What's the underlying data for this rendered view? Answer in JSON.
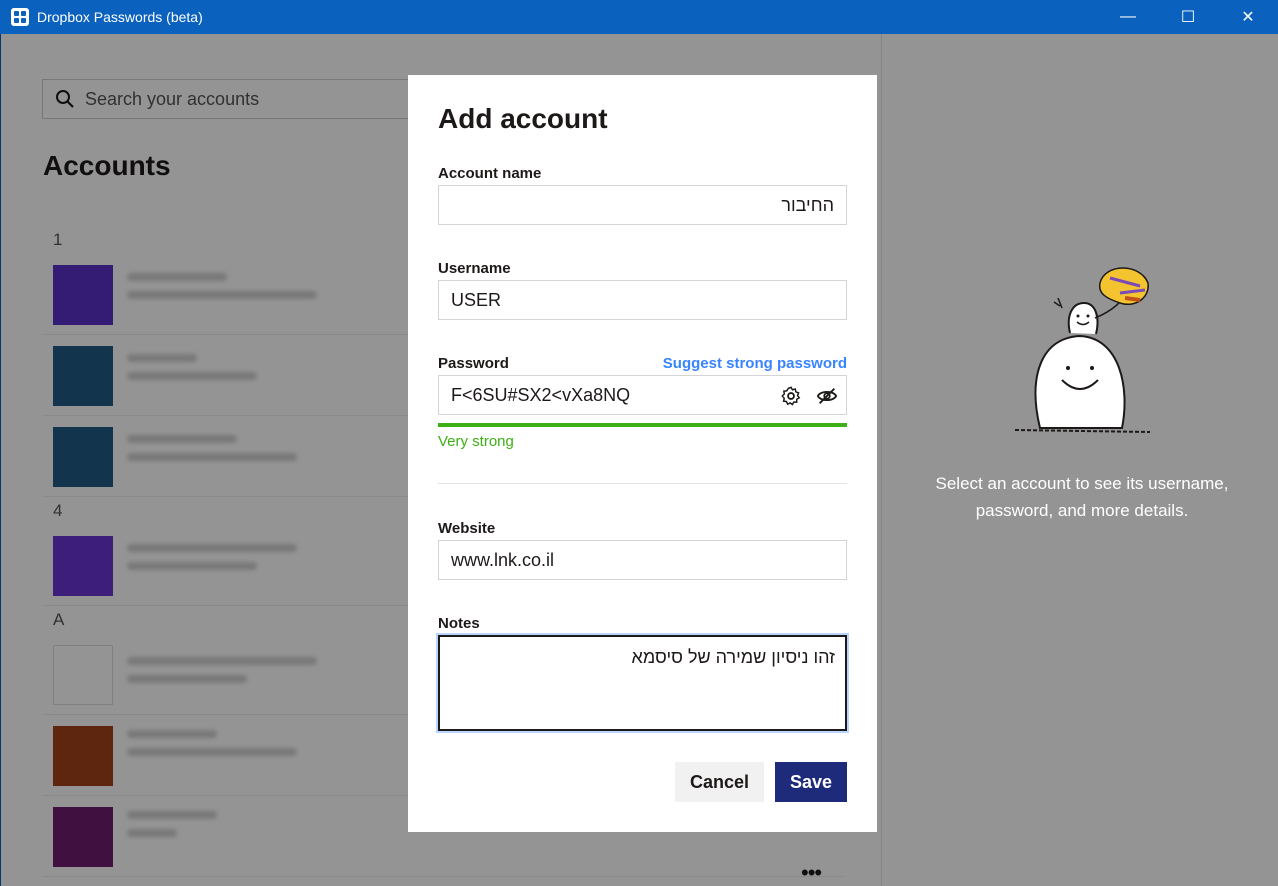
{
  "window": {
    "title": "Dropbox Passwords (beta)"
  },
  "search": {
    "placeholder": "Search your accounts"
  },
  "accounts": {
    "title": "Accounts",
    "groups": [
      {
        "letter": "1"
      },
      {
        "letter": "4"
      },
      {
        "letter": "A"
      }
    ]
  },
  "tile_colors": [
    "#5a2fc6",
    "#1f5a85",
    "#1f5a85",
    "#6a35d4",
    "#ffffff",
    "#a2431a",
    "#6e1c6e"
  ],
  "empty_state": {
    "text": "Select an account to see its username, password, and more details."
  },
  "dialog": {
    "title": "Add account",
    "account_name": {
      "label": "Account name",
      "value": "החיבור"
    },
    "username": {
      "label": "Username",
      "value": "USER"
    },
    "password": {
      "label": "Password",
      "value": "F<6SU#SX2<vXa8NQ",
      "suggest": "Suggest strong password",
      "strength": "Very strong",
      "strength_color": "#3cb015"
    },
    "website": {
      "label": "Website",
      "value": "www.lnk.co.il"
    },
    "notes": {
      "label": "Notes",
      "value": "זהו ניסיון שמירה של סיסמא"
    },
    "cancel": "Cancel",
    "save": "Save"
  },
  "colors": {
    "titlebar": "#0a61be",
    "save_button": "#1e2a7a",
    "link": "#3984ff"
  }
}
